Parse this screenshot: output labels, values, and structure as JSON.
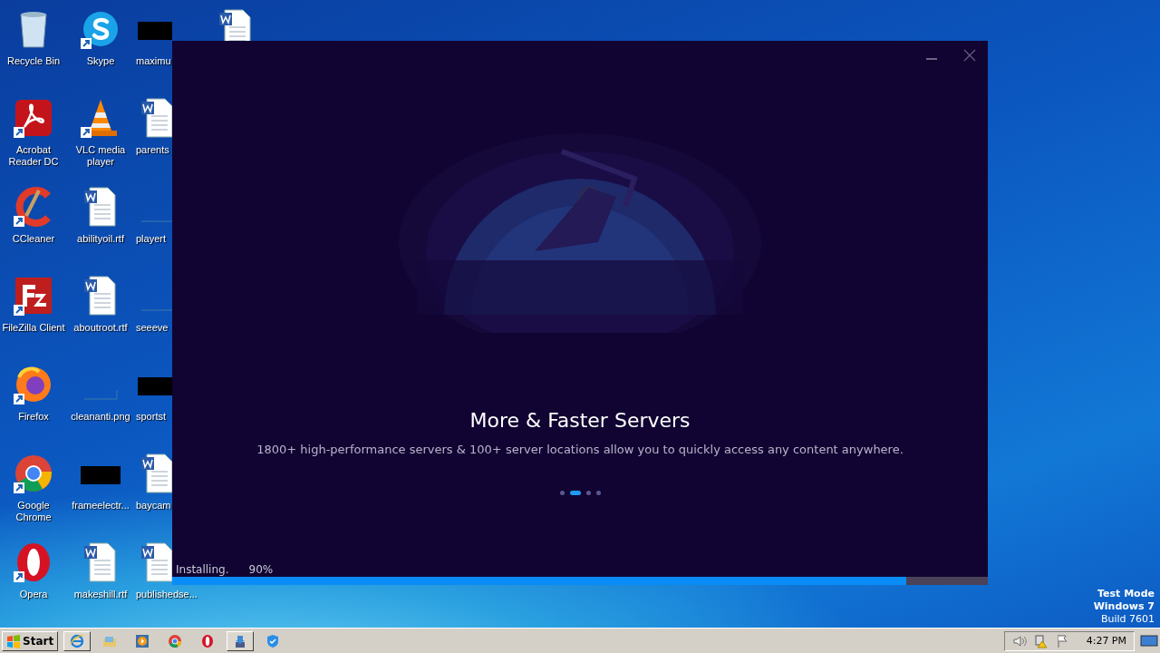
{
  "desktop": {
    "icons": [
      {
        "label": "Recycle Bin",
        "kind": "recycle",
        "shortcut": false
      },
      {
        "label": "Acrobat Reader DC",
        "kind": "acrobat",
        "shortcut": true
      },
      {
        "label": "CCleaner",
        "kind": "ccleaner",
        "shortcut": true
      },
      {
        "label": "FileZilla Client",
        "kind": "filezilla",
        "shortcut": true
      },
      {
        "label": "Firefox",
        "kind": "firefox",
        "shortcut": true
      },
      {
        "label": "Google Chrome",
        "kind": "chrome",
        "shortcut": true
      },
      {
        "label": "Opera",
        "kind": "opera",
        "shortcut": true
      },
      {
        "label": "Skype",
        "kind": "skype",
        "shortcut": true
      },
      {
        "label": "VLC media player",
        "kind": "vlc",
        "shortcut": true
      },
      {
        "label": "abilityoil.rtf",
        "kind": "word",
        "shortcut": false
      },
      {
        "label": "aboutroot.rtf",
        "kind": "word",
        "shortcut": false
      },
      {
        "label": "cleananti.png",
        "kind": "blank",
        "shortcut": false
      },
      {
        "label": "frameelectr...",
        "kind": "dark",
        "shortcut": false
      },
      {
        "label": "makeshill.rtf",
        "kind": "word",
        "shortcut": false
      },
      {
        "label": "maximu",
        "kind": "dark",
        "shortcut": false
      },
      {
        "label": "parents",
        "kind": "word",
        "shortcut": false
      },
      {
        "label": "playert",
        "kind": "blank",
        "shortcut": false
      },
      {
        "label": "seeeve",
        "kind": "blank",
        "shortcut": false
      },
      {
        "label": "sportst",
        "kind": "dark",
        "shortcut": false
      },
      {
        "label": "baycam",
        "kind": "word",
        "shortcut": false
      },
      {
        "label": "publishedse...",
        "kind": "word",
        "shortcut": false
      },
      {
        "kind": "word",
        "shortcut": false
      }
    ]
  },
  "installer": {
    "title": "More & Faster Servers",
    "subtitle": "1800+ high-performance servers & 100+ server locations allow you to quickly access any content anywhere.",
    "slides": [
      {
        "selected": false
      },
      {
        "selected": true
      },
      {
        "selected": false
      },
      {
        "selected": false
      }
    ],
    "status": "Installing.",
    "percent": "90%",
    "level": 0.9
  },
  "watermark": {
    "lines": [
      "Test Mode",
      "Windows 7",
      "Build 7601"
    ]
  },
  "taskbar": {
    "start": "Start",
    "items": [
      {
        "kind": "ie",
        "pressed": true
      },
      {
        "kind": "explorer",
        "pressed": false
      },
      {
        "kind": "media",
        "pressed": false
      },
      {
        "kind": "chrome",
        "pressed": false
      },
      {
        "kind": "opera",
        "pressed": false
      },
      {
        "kind": "installer",
        "pressed": true
      },
      {
        "kind": "shield",
        "pressed": false
      }
    ],
    "clock": "4:27 PM"
  }
}
